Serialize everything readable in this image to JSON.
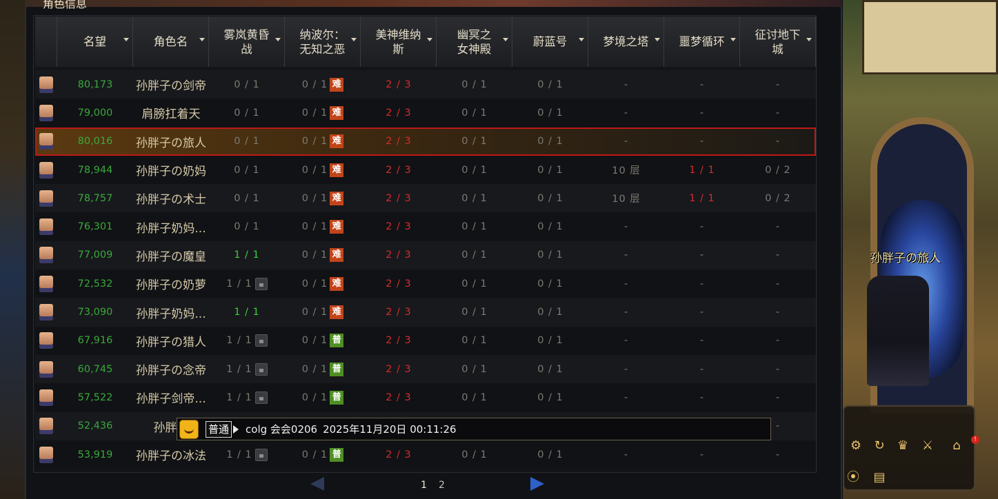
{
  "panel": {
    "title": "角色信息"
  },
  "columns": [
    {
      "label": "名望",
      "sortable": true
    },
    {
      "label": "角色名",
      "sortable": true
    },
    {
      "label": "雾岚黄昏\n战",
      "sortable": true
    },
    {
      "label": "纳波尔：\n无知之恶",
      "sortable": true
    },
    {
      "label": "美神维纳\n斯",
      "sortable": true
    },
    {
      "label": "幽冥之\n女神殿",
      "sortable": true
    },
    {
      "label": "蔚蓝号",
      "sortable": true
    },
    {
      "label": "梦境之塔",
      "sortable": true
    },
    {
      "label": "噩梦循环",
      "sortable": true
    },
    {
      "label": "征讨地下\n城",
      "sortable": true
    }
  ],
  "rows": [
    {
      "fame": "80,173",
      "name": "孙胖子の剑帝",
      "fog": "0 / 1",
      "fog_status": "gray",
      "fog_lock": false,
      "nabor": "0 / 1",
      "nabor_badge": "难",
      "nabor_badge_type": "hard",
      "venus": "2 / 3",
      "underworld": "0 / 1",
      "blue": "0 / 1",
      "tower": "-",
      "nightmare": "-",
      "nightmare_status": "gray",
      "conquest": "-"
    },
    {
      "fame": "79,000",
      "name": "肩膀扛着天",
      "fog": "0 / 1",
      "fog_status": "gray",
      "fog_lock": false,
      "nabor": "0 / 1",
      "nabor_badge": "难",
      "nabor_badge_type": "hard",
      "venus": "2 / 3",
      "underworld": "0 / 1",
      "blue": "0 / 1",
      "tower": "-",
      "nightmare": "-",
      "nightmare_status": "gray",
      "conquest": "-"
    },
    {
      "fame": "80,016",
      "name": "孙胖子の旅人",
      "fog": "0 / 1",
      "fog_status": "gray",
      "fog_lock": false,
      "nabor": "0 / 1",
      "nabor_badge": "难",
      "nabor_badge_type": "hard",
      "venus": "2 / 3",
      "underworld": "0 / 1",
      "blue": "0 / 1",
      "tower": "-",
      "nightmare": "-",
      "nightmare_status": "gray",
      "conquest": "-",
      "selected": true
    },
    {
      "fame": "78,944",
      "name": "孙胖子の奶妈",
      "fog": "0 / 1",
      "fog_status": "gray",
      "fog_lock": false,
      "nabor": "0 / 1",
      "nabor_badge": "难",
      "nabor_badge_type": "hard",
      "venus": "2 / 3",
      "underworld": "0 / 1",
      "blue": "0 / 1",
      "tower": "10 层",
      "nightmare": "1 / 1",
      "nightmare_status": "red",
      "conquest": "0 / 2"
    },
    {
      "fame": "78,757",
      "name": "孙胖子の术士",
      "fog": "0 / 1",
      "fog_status": "gray",
      "fog_lock": false,
      "nabor": "0 / 1",
      "nabor_badge": "难",
      "nabor_badge_type": "hard",
      "venus": "2 / 3",
      "underworld": "0 / 1",
      "blue": "0 / 1",
      "tower": "10 层",
      "nightmare": "1 / 1",
      "nightmare_status": "red",
      "conquest": "0 / 2"
    },
    {
      "fame": "76,301",
      "name": "孙胖子奶妈...",
      "fog": "0 / 1",
      "fog_status": "gray",
      "fog_lock": false,
      "nabor": "0 / 1",
      "nabor_badge": "难",
      "nabor_badge_type": "hard",
      "venus": "2 / 3",
      "underworld": "0 / 1",
      "blue": "0 / 1",
      "tower": "-",
      "nightmare": "-",
      "nightmare_status": "gray",
      "conquest": "-"
    },
    {
      "fame": "77,009",
      "name": "孙胖子の魔皇",
      "fog": "1 / 1",
      "fog_status": "green",
      "fog_lock": false,
      "nabor": "0 / 1",
      "nabor_badge": "难",
      "nabor_badge_type": "hard",
      "venus": "2 / 3",
      "underworld": "0 / 1",
      "blue": "0 / 1",
      "tower": "-",
      "nightmare": "-",
      "nightmare_status": "gray",
      "conquest": "-"
    },
    {
      "fame": "72,532",
      "name": "孙胖子の奶萝",
      "fog": "1 / 1",
      "fog_status": "gray",
      "fog_lock": true,
      "nabor": "0 / 1",
      "nabor_badge": "难",
      "nabor_badge_type": "hard",
      "venus": "2 / 3",
      "underworld": "0 / 1",
      "blue": "0 / 1",
      "tower": "-",
      "nightmare": "-",
      "nightmare_status": "gray",
      "conquest": "-"
    },
    {
      "fame": "73,090",
      "name": "孙胖子奶妈...",
      "fog": "1 / 1",
      "fog_status": "green",
      "fog_lock": false,
      "nabor": "0 / 1",
      "nabor_badge": "难",
      "nabor_badge_type": "hard",
      "venus": "2 / 3",
      "underworld": "0 / 1",
      "blue": "0 / 1",
      "tower": "-",
      "nightmare": "-",
      "nightmare_status": "gray",
      "conquest": "-"
    },
    {
      "fame": "67,916",
      "name": "孙胖子の猎人",
      "fog": "1 / 1",
      "fog_status": "gray",
      "fog_lock": true,
      "nabor": "0 / 1",
      "nabor_badge": "普",
      "nabor_badge_type": "normal",
      "venus": "2 / 3",
      "underworld": "0 / 1",
      "blue": "0 / 1",
      "tower": "-",
      "nightmare": "-",
      "nightmare_status": "gray",
      "conquest": "-"
    },
    {
      "fame": "60,745",
      "name": "孙胖子の念帝",
      "fog": "1 / 1",
      "fog_status": "gray",
      "fog_lock": true,
      "nabor": "0 / 1",
      "nabor_badge": "普",
      "nabor_badge_type": "normal",
      "venus": "2 / 3",
      "underworld": "0 / 1",
      "blue": "0 / 1",
      "tower": "-",
      "nightmare": "-",
      "nightmare_status": "gray",
      "conquest": "-"
    },
    {
      "fame": "57,522",
      "name": "孙胖子剑帝...",
      "fog": "1 / 1",
      "fog_status": "gray",
      "fog_lock": true,
      "nabor": "0 / 1",
      "nabor_badge": "普",
      "nabor_badge_type": "normal",
      "venus": "2 / 3",
      "underworld": "0 / 1",
      "blue": "0 / 1",
      "tower": "-",
      "nightmare": "-",
      "nightmare_status": "gray",
      "conquest": "-"
    },
    {
      "fame": "52,436",
      "name": "孙胖子",
      "fog": "",
      "fog_status": "gray",
      "fog_lock": false,
      "nabor": "",
      "nabor_badge": "",
      "nabor_badge_type": "",
      "venus": "",
      "underworld": "",
      "blue": "",
      "tower": "",
      "nightmare": "",
      "nightmare_status": "gray",
      "conquest": "-"
    },
    {
      "fame": "53,919",
      "name": "孙胖子の冰法",
      "fog": "1 / 1",
      "fog_status": "gray",
      "fog_lock": true,
      "nabor": "0 / 1",
      "nabor_badge": "普",
      "nabor_badge_type": "normal",
      "venus": "2 / 3",
      "underworld": "0 / 1",
      "blue": "0 / 1",
      "tower": "-",
      "nightmare": "-",
      "nightmare_status": "gray",
      "conquest": "-"
    }
  ],
  "pager": {
    "pages": [
      "1",
      "2"
    ],
    "current": "1"
  },
  "chat": {
    "channel": "普通",
    "sender": "colg 会会0206",
    "timestamp": "2025年11月20日 00:11:26"
  },
  "scene": {
    "character_name": "孙胖子の旅人",
    "notification_count": "!"
  },
  "colors": {
    "fame": "#3ca83c",
    "complete": "#38d238",
    "venus": "#d42d2d",
    "hard_badge": "#c2451a",
    "normal_badge": "#4f8f24",
    "selected_outline": "#c01818"
  }
}
